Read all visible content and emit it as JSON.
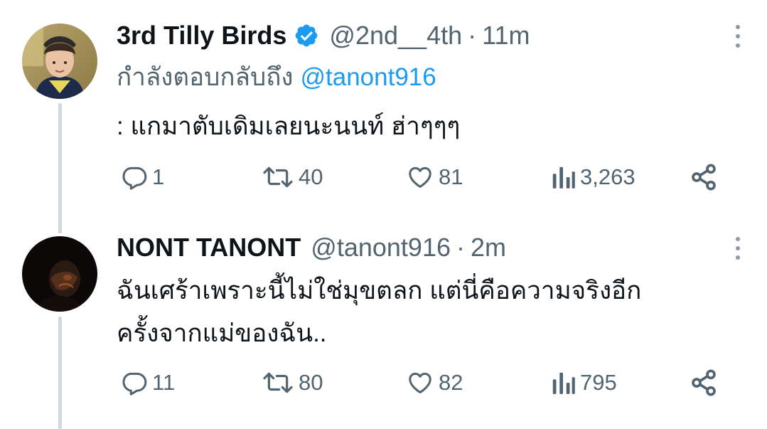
{
  "tweets": [
    {
      "display_name": "3rd Tilly Birds",
      "verified": true,
      "handle": "@2nd__4th",
      "separator": "·",
      "time": "11m",
      "replying_prefix": "กำลังตอบกลับถึง",
      "replying_to": "@tanont916",
      "text": ": แกมาตับเดิมเลยนะนนท์ ฮ่าๆๆๆ",
      "stats": {
        "replies": "1",
        "retweets": "40",
        "likes": "81",
        "views": "3,263"
      }
    },
    {
      "display_name": "NONT TANONT",
      "verified": false,
      "handle": "@tanont916",
      "separator": "·",
      "time": "2m",
      "text_line1": "ฉันเศร้าเพราะนี้ไม่ใช่มุขตลก แต่นี่คือความจริงอีก",
      "text_line2": "ครั้งจากแม่ของฉัน..",
      "stats": {
        "replies": "11",
        "retweets": "80",
        "likes": "82",
        "views": "795"
      }
    }
  ],
  "icons": {
    "reply": "reply-icon",
    "retweet": "retweet-icon",
    "like": "heart-icon",
    "views": "views-icon",
    "share": "share-icon",
    "more": "more-icon",
    "verified": "verified-badge-icon"
  },
  "colors": {
    "text": "#0f1419",
    "secondary": "#536471",
    "accent": "#1d9bf0",
    "thread_line": "#cfd9de"
  }
}
